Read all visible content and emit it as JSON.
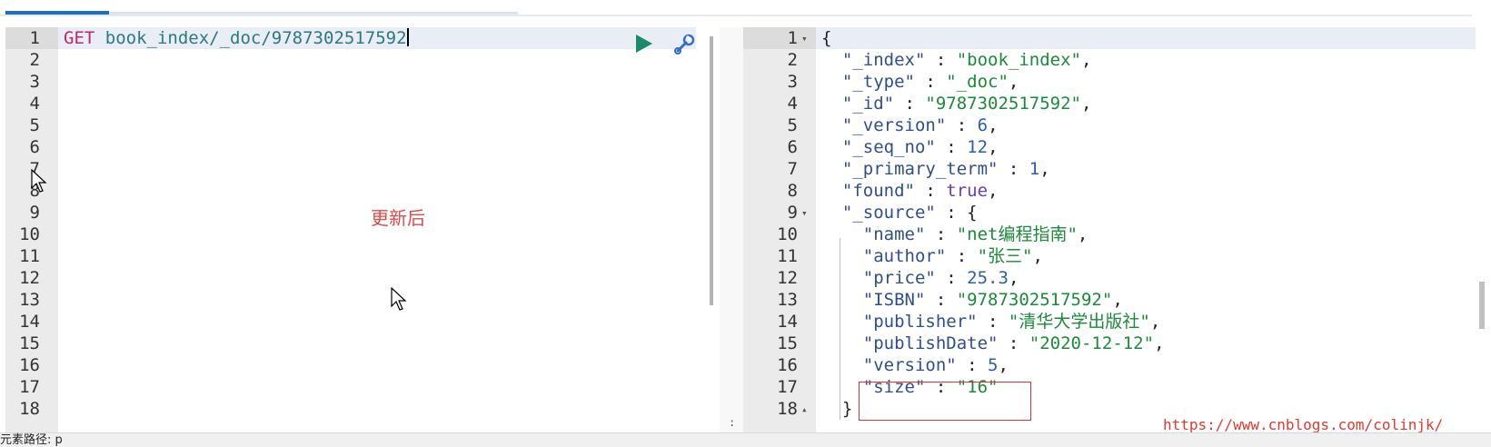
{
  "request": {
    "method": "GET",
    "path": "book_index/_doc/9787302517592",
    "line_numbers": [
      "1",
      "2",
      "3",
      "4",
      "5",
      "6",
      "7",
      "8",
      "9",
      "10",
      "11",
      "12",
      "13",
      "14",
      "15",
      "16",
      "17",
      "18"
    ]
  },
  "annotation": "更新后",
  "response": {
    "line_numbers": [
      "1",
      "2",
      "3",
      "4",
      "5",
      "6",
      "7",
      "8",
      "9",
      "10",
      "11",
      "12",
      "13",
      "14",
      "15",
      "16",
      "17",
      "18"
    ],
    "lines": [
      [
        {
          "t": "{",
          "c": "punct"
        }
      ],
      [
        {
          "t": "  \"_index\"",
          "c": "key"
        },
        {
          "t": " : ",
          "c": "punct"
        },
        {
          "t": "\"book_index\"",
          "c": "str"
        },
        {
          "t": ",",
          "c": "punct"
        }
      ],
      [
        {
          "t": "  \"_type\"",
          "c": "key"
        },
        {
          "t": " : ",
          "c": "punct"
        },
        {
          "t": "\"_doc\"",
          "c": "str"
        },
        {
          "t": ",",
          "c": "punct"
        }
      ],
      [
        {
          "t": "  \"_id\"",
          "c": "key"
        },
        {
          "t": " : ",
          "c": "punct"
        },
        {
          "t": "\"9787302517592\"",
          "c": "str"
        },
        {
          "t": ",",
          "c": "punct"
        }
      ],
      [
        {
          "t": "  \"_version\"",
          "c": "key"
        },
        {
          "t": " : ",
          "c": "punct"
        },
        {
          "t": "6",
          "c": "num"
        },
        {
          "t": ",",
          "c": "punct"
        }
      ],
      [
        {
          "t": "  \"_seq_no\"",
          "c": "key"
        },
        {
          "t": " : ",
          "c": "punct"
        },
        {
          "t": "12",
          "c": "num"
        },
        {
          "t": ",",
          "c": "punct"
        }
      ],
      [
        {
          "t": "  \"_primary_term\"",
          "c": "key"
        },
        {
          "t": " : ",
          "c": "punct"
        },
        {
          "t": "1",
          "c": "num"
        },
        {
          "t": ",",
          "c": "punct"
        }
      ],
      [
        {
          "t": "  \"found\"",
          "c": "key"
        },
        {
          "t": " : ",
          "c": "punct"
        },
        {
          "t": "true",
          "c": "bool"
        },
        {
          "t": ",",
          "c": "punct"
        }
      ],
      [
        {
          "t": "  \"_source\"",
          "c": "key"
        },
        {
          "t": " : {",
          "c": "punct"
        }
      ],
      [
        {
          "t": "    \"name\"",
          "c": "key"
        },
        {
          "t": " : ",
          "c": "punct"
        },
        {
          "t": "\"net编程指南\"",
          "c": "str"
        },
        {
          "t": ",",
          "c": "punct"
        }
      ],
      [
        {
          "t": "    \"author\"",
          "c": "key"
        },
        {
          "t": " : ",
          "c": "punct"
        },
        {
          "t": "\"张三\"",
          "c": "str"
        },
        {
          "t": ",",
          "c": "punct"
        }
      ],
      [
        {
          "t": "    \"price\"",
          "c": "key"
        },
        {
          "t": " : ",
          "c": "punct"
        },
        {
          "t": "25.3",
          "c": "num"
        },
        {
          "t": ",",
          "c": "punct"
        }
      ],
      [
        {
          "t": "    \"ISBN\"",
          "c": "key"
        },
        {
          "t": " : ",
          "c": "punct"
        },
        {
          "t": "\"9787302517592\"",
          "c": "str"
        },
        {
          "t": ",",
          "c": "punct"
        }
      ],
      [
        {
          "t": "    \"publisher\"",
          "c": "key"
        },
        {
          "t": " : ",
          "c": "punct"
        },
        {
          "t": "\"清华大学出版社\"",
          "c": "str"
        },
        {
          "t": ",",
          "c": "punct"
        }
      ],
      [
        {
          "t": "    \"publishDate\"",
          "c": "key"
        },
        {
          "t": " : ",
          "c": "punct"
        },
        {
          "t": "\"2020-12-12\"",
          "c": "str"
        },
        {
          "t": ",",
          "c": "punct"
        }
      ],
      [
        {
          "t": "    \"version\"",
          "c": "key"
        },
        {
          "t": " : ",
          "c": "punct"
        },
        {
          "t": "5",
          "c": "num"
        },
        {
          "t": ",",
          "c": "punct"
        }
      ],
      [
        {
          "t": "    \"size\"",
          "c": "key"
        },
        {
          "t": " : ",
          "c": "punct"
        },
        {
          "t": "\"16\"",
          "c": "str"
        }
      ],
      [
        {
          "t": "  }",
          "c": "punct"
        }
      ]
    ]
  },
  "splitter_label": ":",
  "watermark": "https://www.cnblogs.com/colinjk/",
  "status_text": "元素路径: p",
  "icons": {
    "run": "play-icon",
    "settings": "wrench-icon"
  },
  "colors": {
    "run": "#1a8a6a",
    "wrench": "#2f6fc9",
    "annotation": "#e54848",
    "highlight": "#e03434"
  }
}
